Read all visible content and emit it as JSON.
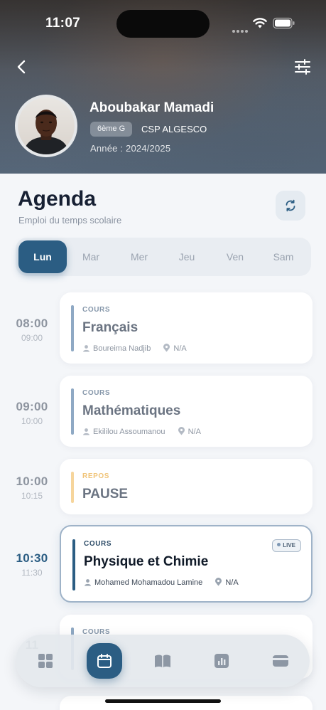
{
  "status_bar": {
    "time": "11:07"
  },
  "profile": {
    "name": "Aboubakar Mamadi",
    "class": "6ème G",
    "school": "CSP ALGESCO",
    "year": "Année : 2024/2025"
  },
  "agenda": {
    "title": "Agenda",
    "subtitle": "Emploi du temps scolaire"
  },
  "days": [
    "Lun",
    "Mar",
    "Mer",
    "Jeu",
    "Ven",
    "Sam"
  ],
  "active_day": "Lun",
  "schedule": [
    {
      "start": "08:00",
      "end": "09:00",
      "kind": "COURS",
      "subject": "Français",
      "teacher": "Boureima Nadjib",
      "location": "N/A"
    },
    {
      "start": "09:00",
      "end": "10:00",
      "kind": "COURS",
      "subject": "Mathématiques",
      "teacher": "Ekililou Assoumanou",
      "location": "N/A"
    },
    {
      "start": "10:00",
      "end": "10:15",
      "kind": "REPOS",
      "subject": "PAUSE"
    },
    {
      "start": "10:30",
      "end": "11:30",
      "kind": "COURS",
      "subject": "Physique et Chimie",
      "teacher": "Mohamed Mohamadou Lamine",
      "location": "N/A",
      "live": "LIVE"
    },
    {
      "start": "11",
      "kind": "COURS"
    }
  ],
  "nav": [
    "grid-icon",
    "calendar-icon",
    "book-icon",
    "chart-icon",
    "wallet-icon"
  ],
  "colors": {
    "primary": "#2b5d83",
    "pause": "#f6d59c",
    "background": "#f4f6f9"
  }
}
